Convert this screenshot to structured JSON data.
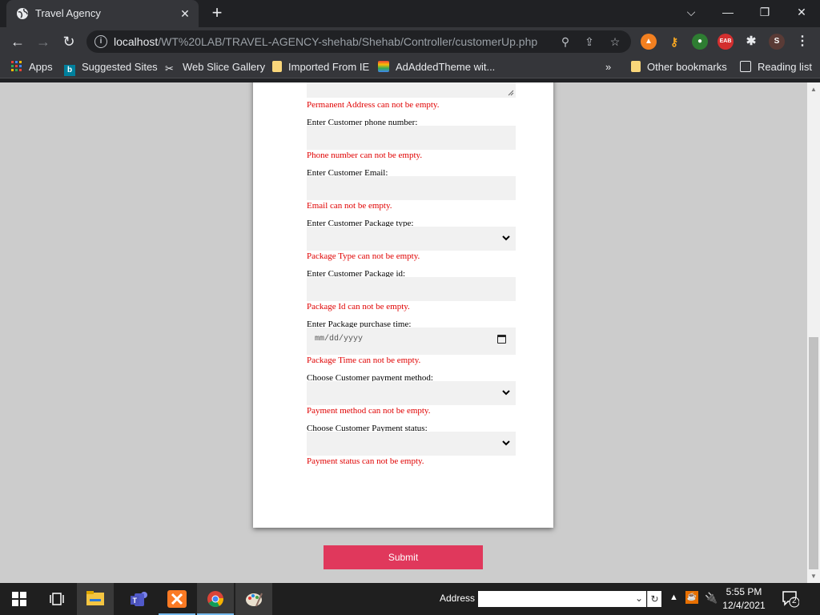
{
  "browser": {
    "tab_title": "Travel Agency",
    "url_host": "localhost",
    "url_path": "/WT%20LAB/TRAVEL-AGENCY-shehab/Shehab/Controller/customerUp.php",
    "profile_initial": "S",
    "bookmarks": {
      "apps": "Apps",
      "suggested": "Suggested Sites",
      "webslice": "Web Slice Gallery",
      "imported": "Imported From IE",
      "adadded": "AdAddedTheme wit...",
      "overflow": "»",
      "other": "Other bookmarks",
      "reading": "Reading list"
    }
  },
  "form": {
    "permanent_address_error": "Permanent Address can not be empty.",
    "phone_label": "Enter Customer phone number:",
    "phone_error": "Phone number can not be empty.",
    "email_label": "Enter Customer Email:",
    "email_error": "Email can not be empty.",
    "package_type_label": "Enter Customer Package type:",
    "package_type_error": "Package Type can not be empty.",
    "package_id_label": "Enter Customer Package id:",
    "package_id_error": "Package Id can not be empty.",
    "purchase_time_label": "Enter Package purchase time:",
    "purchase_time_placeholder": "mm/dd/yyyy",
    "purchase_time_error": "Package Time can not be empty.",
    "payment_method_label": "Choose Customer payment method:",
    "payment_method_error": "Payment method can not be empty.",
    "payment_status_label": "Choose Customer Payment status:",
    "payment_status_error": "Payment status can not be empty.",
    "submit_label": "Submit"
  },
  "taskbar": {
    "address_label": "Address",
    "time": "5:55 PM",
    "date": "12/4/2021",
    "notification_count": "2"
  },
  "colors": {
    "error": "#e00000",
    "submit": "#e0385c",
    "page_bg": "#cccccc"
  }
}
